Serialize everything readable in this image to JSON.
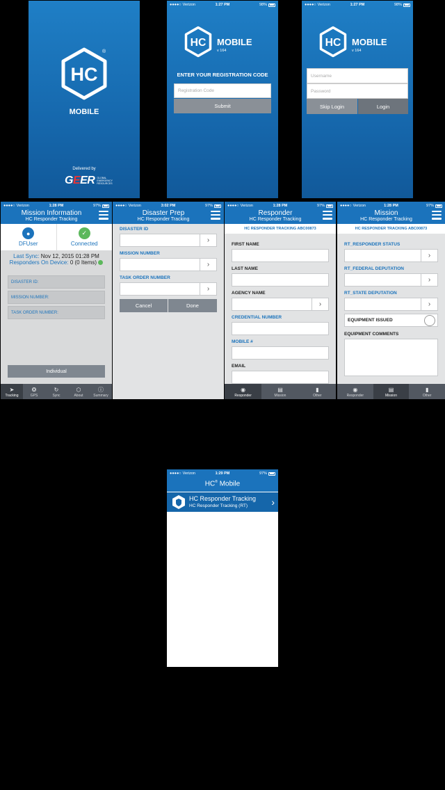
{
  "colors": {
    "brand_blue": "#1b73bc",
    "tab_gray": "#525861",
    "button_gray": "#8a9097",
    "connected_green": "#5cb85c",
    "background": "#000000"
  },
  "status": {
    "carrier": "Verizon",
    "battery_a": "98%",
    "battery_b": "97%",
    "time_a": "1:27 PM",
    "time_b": "1:28 PM",
    "time_c": "3:02 PM",
    "time_d": "1:29 PM"
  },
  "logo": {
    "hc": "HC",
    "mobile": "MOBILE",
    "version": "v 164",
    "registered": "®"
  },
  "splash": {
    "delivered_by": "Delivered by",
    "gear_sub": "GLOBAL EMERGENCY RESOURCES"
  },
  "registration": {
    "title": "ENTER YOUR REGISTRATION CODE",
    "placeholder": "Registration Code",
    "submit": "Submit"
  },
  "login": {
    "username_placeholder": "Username",
    "password_placeholder": "Password",
    "skip": "Skip Login",
    "login": "Login"
  },
  "mission_info": {
    "title": "Mission Information",
    "subtitle": "HC Responder Tracking",
    "user": "DFUser",
    "connection": "Connected",
    "last_sync_label": "Last Sync:",
    "last_sync_value": "Nov 12, 2015 01:28 PM",
    "responders_label": "Responders On Device:",
    "responders_value": "0 (0 Items)",
    "rows": [
      "DISASTER ID:",
      "MISSION NUMBER:",
      "TASK ORDER NUMBER:"
    ],
    "individual": "Individual",
    "tabs": [
      "Tracking",
      "GPS",
      "Sync",
      "About",
      "Summary"
    ]
  },
  "disaster_prep": {
    "title": "Disaster Prep",
    "subtitle": "HC Responder Tracking",
    "fields": [
      "DISASTER ID",
      "MISSION NUMBER",
      "TASK ORDER NUMBER"
    ],
    "cancel": "Cancel",
    "done": "Done"
  },
  "responder": {
    "title": "Responder",
    "subtitle": "HC Responder Tracking",
    "id_strip": "HC RESPONDER TRACKING ABC00873",
    "fields": [
      "FIRST NAME",
      "LAST NAME",
      "AGENCY NAME",
      "CREDENTIAL NUMBER",
      "MOBILE #",
      "EMAIL"
    ],
    "tabs": [
      "Responder",
      "Mission",
      "Other"
    ]
  },
  "mission": {
    "title": "Mission",
    "subtitle": "HC Responder Tracking",
    "id_strip": "HC RESPONDER TRACKING ABC00873",
    "fields": [
      "RT_RESPONDER STATUS",
      "RT_FEDERAL DEPUTATION",
      "RT_STATE DEPUTATION"
    ],
    "equipment_issued": "EQUIPMENT ISSUED",
    "equipment_comments": "EQUIPMENT COMMENTS",
    "tabs": [
      "Responder",
      "Mission",
      "Other"
    ]
  },
  "hc_mobile_list": {
    "title_hc": "HC",
    "title_sup": "®",
    "title_rest": " Mobile",
    "item_title": "HC Responder Tracking",
    "item_sub": "HC Responder Tracking (RT)"
  }
}
